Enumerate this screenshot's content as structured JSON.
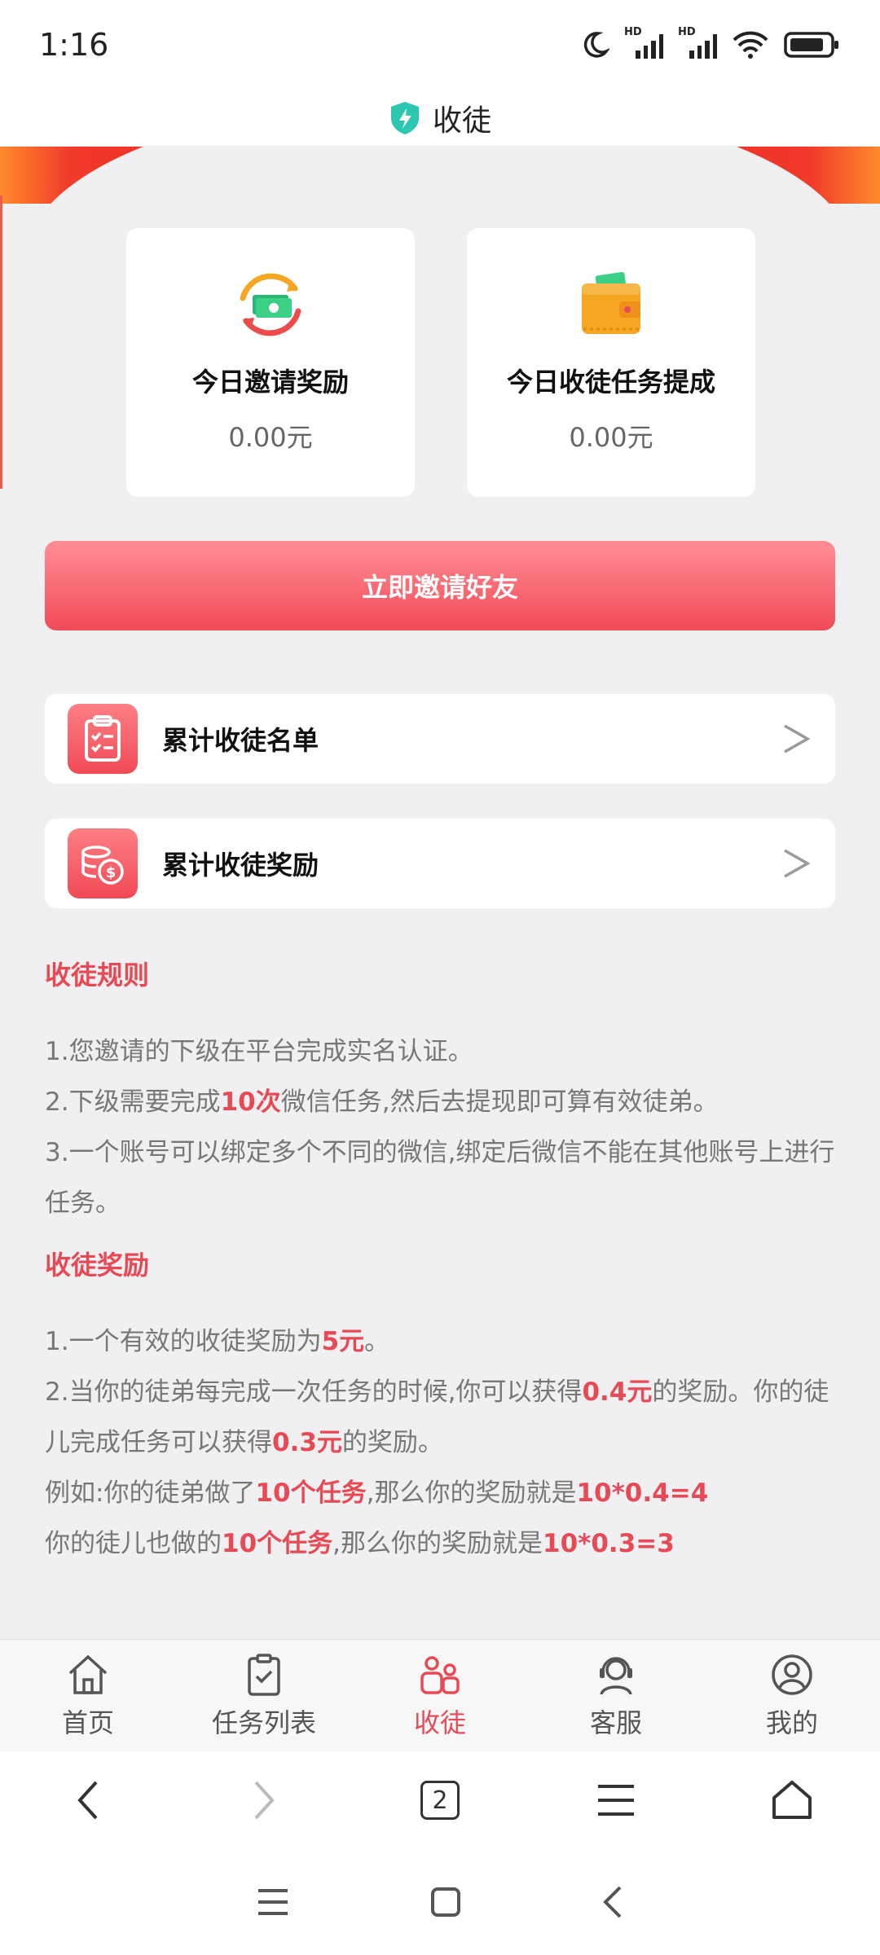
{
  "status_bar": {
    "time": "1:16",
    "signal_tag": "HD"
  },
  "header": {
    "title": "收徒"
  },
  "cards": [
    {
      "label": "今日邀请奖励",
      "value": "0.00元",
      "icon": "money-exchange-icon"
    },
    {
      "label": "今日收徒任务提成",
      "value": "0.00元",
      "icon": "wallet-icon"
    }
  ],
  "invite_button": {
    "label": "立即邀请好友"
  },
  "list": [
    {
      "label": "累计收徒名单",
      "icon": "checklist-icon"
    },
    {
      "label": "累计收徒奖励",
      "icon": "coins-icon"
    }
  ],
  "rules": {
    "title": "收徒规则",
    "line1": "1.您邀请的下级在平台完成实名认证。",
    "line2_pre": "2.下级需要完成",
    "line2_hl": "10次",
    "line2_post": "微信任务,然后去提现即可算有效徒弟。",
    "line3": "3.一个账号可以绑定多个不同的微信,绑定后微信不能在其他账号上进行任务。"
  },
  "rewards": {
    "title": "收徒奖励",
    "line1_pre": "1.一个有效的收徒奖励为",
    "line1_hl": "5元",
    "line1_post": "。",
    "line2_pre": "2.当你的徒弟每完成一次任务的时候,你可以获得",
    "line2_hl": "0.4元",
    "line2_mid": "的奖励。你的徒儿完成任务可以获得",
    "line2_hl2": "0.3元",
    "line2_post": "的奖励。",
    "ex1_pre": "例如:你的徒弟做了",
    "ex1_hl": "10个任务",
    "ex1_mid": ",那么你的奖励就是",
    "ex1_hl2": "10*0.4=4",
    "ex2_pre": "你的徒儿也做的",
    "ex2_hl": "10个任务",
    "ex2_mid": ",那么你的奖励就是",
    "ex2_hl2": "10*0.3=3"
  },
  "tabs": [
    {
      "label": "首页",
      "icon": "home-icon",
      "active": false
    },
    {
      "label": "任务列表",
      "icon": "task-list-icon",
      "active": false
    },
    {
      "label": "收徒",
      "icon": "people-icon",
      "active": true
    },
    {
      "label": "客服",
      "icon": "customer-service-icon",
      "active": false
    },
    {
      "label": "我的",
      "icon": "user-icon",
      "active": false
    }
  ],
  "browser": {
    "tab_count": "2"
  },
  "colors": {
    "accent": "#e84a55",
    "band": "#e81e1e",
    "background": "#f0f0f2"
  }
}
